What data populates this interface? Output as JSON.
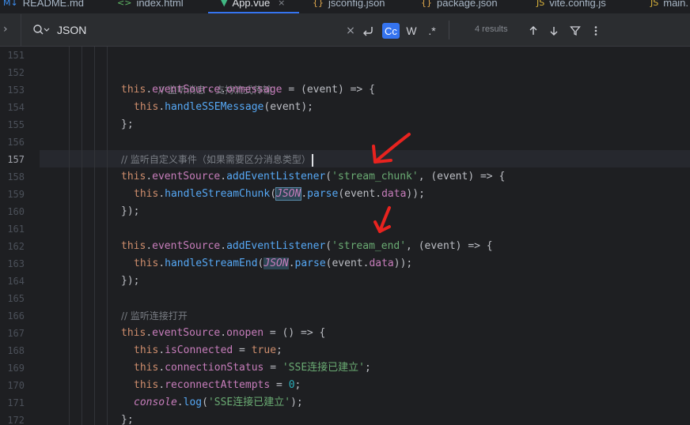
{
  "tabs": [
    {
      "label": "README.md",
      "icon": "markdown-icon",
      "active": false
    },
    {
      "label": "index.html",
      "icon": "html-icon",
      "active": false
    },
    {
      "label": "App.vue",
      "icon": "vue-icon",
      "active": true
    },
    {
      "label": "jsconfig.json",
      "icon": "json-icon",
      "active": false
    },
    {
      "label": "package.json",
      "icon": "json-icon",
      "active": false
    },
    {
      "label": "vite.config.js",
      "icon": "js-icon",
      "active": false
    },
    {
      "label": "main.",
      "icon": "js-icon",
      "active": false
    }
  ],
  "search": {
    "value": "JSON",
    "match_case_label": "Cc",
    "words_label": "W",
    "regex_label": ".*",
    "results": "4 results"
  },
  "editor": {
    "line_numbers": [
      "151",
      "152",
      "153",
      "154",
      "155",
      "156",
      "157",
      "158",
      "159",
      "160",
      "161",
      "162",
      "163",
      "164",
      "165",
      "166",
      "167",
      "168",
      "169",
      "170",
      "171",
      "172"
    ],
    "current_line": "157",
    "colors": {
      "background": "#1e1f22",
      "keyword": "#cf8e6d",
      "function": "#56a8f5",
      "string": "#6aab73",
      "property": "#c77dbb",
      "comment": "#7a7e85",
      "number": "#2aacb8",
      "match_highlight": "#2d4655",
      "annotation_arrow": "#e8231f"
    },
    "lines": {
      "l152_comment": "// 监听消息 - 支持流式传输",
      "l153_a": "this",
      "l153_b": ".",
      "l153_c": "eventSource",
      "l153_d": ".",
      "l153_e": "onmessage",
      "l153_f": " = (event) => {",
      "l154_a": "this",
      "l154_b": ".",
      "l154_c": "handleSSEMessage",
      "l154_d": "(event);",
      "l155": "};",
      "l157_comment": "// 监听自定义事件（如果需要区分消息类型）",
      "l158_a": "this",
      "l158_b": ".",
      "l158_c": "eventSource",
      "l158_d": ".",
      "l158_e": "addEventListener",
      "l158_f": "(",
      "l158_g": "'stream_chunk'",
      "l158_h": ", (event) => {",
      "l159_a": "this",
      "l159_b": ".",
      "l159_c": "handleStreamChunk",
      "l159_d": "(",
      "l159_e": "JSON",
      "l159_f": ".",
      "l159_g": "parse",
      "l159_h": "(event.",
      "l159_i": "data",
      "l159_j": "));",
      "l160": "});",
      "l162_a": "this",
      "l162_b": ".",
      "l162_c": "eventSource",
      "l162_d": ".",
      "l162_e": "addEventListener",
      "l162_f": "(",
      "l162_g": "'stream_end'",
      "l162_h": ", (event) => {",
      "l163_a": "this",
      "l163_b": ".",
      "l163_c": "handleStreamEnd",
      "l163_d": "(",
      "l163_e": "JSON",
      "l163_f": ".",
      "l163_g": "parse",
      "l163_h": "(event.",
      "l163_i": "data",
      "l163_j": "));",
      "l164": "});",
      "l166_comment": "// 监听连接打开",
      "l167_a": "this",
      "l167_b": ".",
      "l167_c": "eventSource",
      "l167_d": ".",
      "l167_e": "onopen",
      "l167_f": " = () => {",
      "l168_a": "this",
      "l168_b": ".",
      "l168_c": "isConnected",
      "l168_d": " = ",
      "l168_e": "true",
      "l168_f": ";",
      "l169_a": "this",
      "l169_b": ".",
      "l169_c": "connectionStatus",
      "l169_d": " = ",
      "l169_e": "'SSE连接已建立'",
      "l169_f": ";",
      "l170_a": "this",
      "l170_b": ".",
      "l170_c": "reconnectAttempts",
      "l170_d": " = ",
      "l170_e": "0",
      "l170_f": ";",
      "l171_a": "console",
      "l171_b": ".",
      "l171_c": "log",
      "l171_d": "(",
      "l171_e": "'SSE连接已建立'",
      "l171_f": ");",
      "l172": "};"
    }
  }
}
